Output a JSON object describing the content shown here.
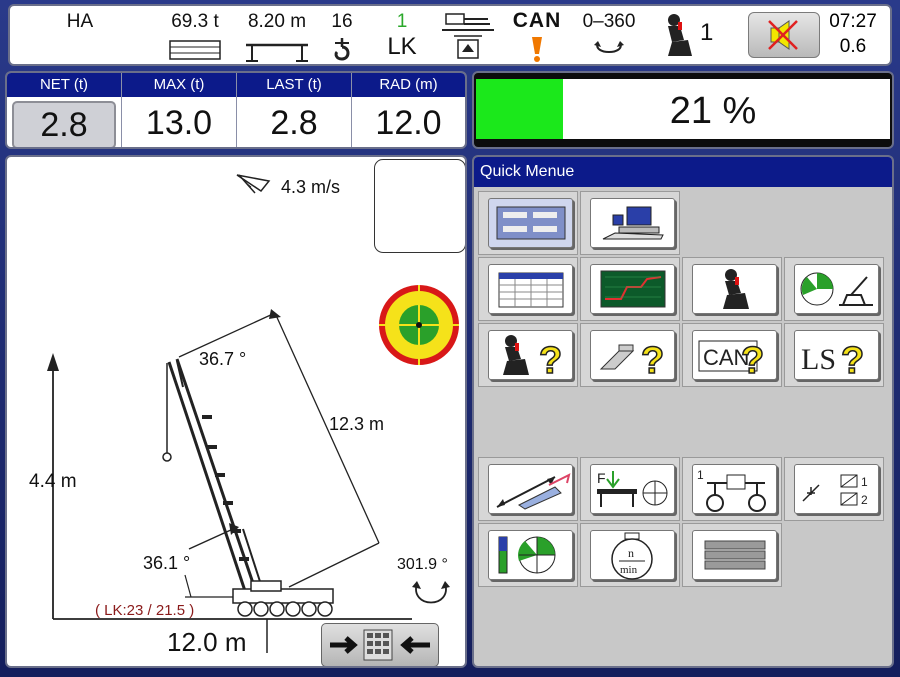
{
  "status": {
    "mode": "HA",
    "weight": "69.3 t",
    "length": "8.20 m",
    "falls": "16",
    "lk_number": "1",
    "lk_label": "LK",
    "can_label": "CAN",
    "slew_range": "0–360",
    "operator_count": "1",
    "clock": "07:27",
    "clock_sub": "0.6"
  },
  "readouts": [
    {
      "label": "NET (t)",
      "value": "2.8"
    },
    {
      "label": "MAX  (t)",
      "value": "13.0"
    },
    {
      "label": "LAST (t)",
      "value": "2.8"
    },
    {
      "label": "RAD (m)",
      "value": "12.0"
    }
  ],
  "load": {
    "percent_text": "21 %",
    "fraction": 0.21,
    "fill_color": "#1be81b"
  },
  "crane": {
    "wind": "4.3 m/s",
    "boom_angle_top": "36.7 °",
    "boom_length": "12.3 m",
    "height": "4.4 m",
    "boom_angle_bottom": "36.1 °",
    "slew_angle": "301.9 °",
    "lk_info": "( LK:23 / 21.5 )",
    "radius": "12.0 m"
  },
  "quick_menu": {
    "title": "Quick Menue"
  },
  "colors": {
    "accent": "#0c1a8a",
    "load_ok": "#1be81b",
    "warning": "#f07800"
  }
}
